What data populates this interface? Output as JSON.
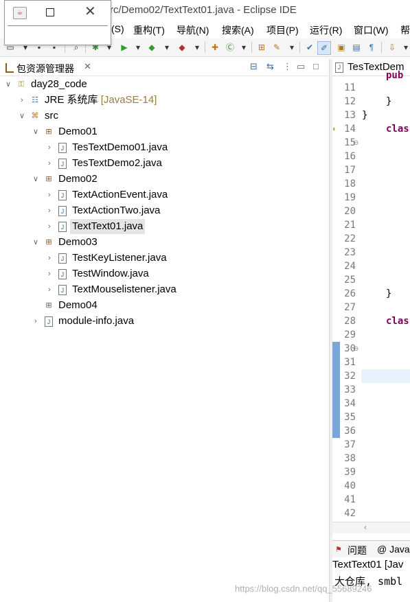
{
  "window": {
    "title": "rc/Demo02/TextText01.java - Eclipse IDE"
  },
  "menu": {
    "items": [
      {
        "label": "(S)"
      },
      {
        "label": "重构(T)"
      },
      {
        "label": "导航(N)"
      },
      {
        "label": "搜索(A)"
      },
      {
        "label": "项目(P)"
      },
      {
        "label": "运行(R)"
      },
      {
        "label": "窗口(W)"
      },
      {
        "label": "帮"
      }
    ]
  },
  "popup": {
    "app_icon": "java-app-icon"
  },
  "left_panel": {
    "title": "包资源管理器",
    "tree": [
      {
        "label": "day28_code",
        "icon": "project-icon"
      },
      {
        "label": "JRE 系统库",
        "suffix": "[JavaSE-14]",
        "icon": "library-icon"
      },
      {
        "label": "src",
        "icon": "source-folder-icon"
      },
      {
        "label": "Demo01",
        "icon": "package-icon"
      },
      {
        "label": "TesTextDemo01.java",
        "icon": "java-file-icon"
      },
      {
        "label": "TesTextDemo2.java",
        "icon": "java-file-icon"
      },
      {
        "label": "Demo02",
        "icon": "package-icon"
      },
      {
        "label": "TextActionEvent.java",
        "icon": "java-file-icon"
      },
      {
        "label": "TextActionTwo.java",
        "icon": "java-file-icon"
      },
      {
        "label": "TextText01.java",
        "icon": "java-file-icon",
        "selected": true
      },
      {
        "label": "Demo03",
        "icon": "package-icon"
      },
      {
        "label": "TestKeyListener.java",
        "icon": "java-file-icon"
      },
      {
        "label": "TestWindow.java",
        "icon": "java-file-icon"
      },
      {
        "label": "TextMouselistener.java",
        "icon": "java-file-icon"
      },
      {
        "label": "Demo04",
        "icon": "empty-package-icon"
      },
      {
        "label": "module-info.java",
        "icon": "java-file-icon"
      }
    ]
  },
  "editor": {
    "tab_label": "TesTextDem",
    "line_numbers": [
      "11",
      "12",
      "13",
      "14",
      "15",
      "16",
      "17",
      "18",
      "19",
      "20",
      "21",
      "22",
      "23",
      "24",
      "25",
      "26",
      "27",
      "28",
      "29",
      "30",
      "31",
      "32",
      "33",
      "34",
      "35",
      "36",
      "37",
      "38",
      "39",
      "40",
      "41",
      "42"
    ],
    "code": {
      "line10": "pub",
      "line12": "}",
      "line13": "}",
      "line14": "clas",
      "line26": "}",
      "line28": "clas"
    }
  },
  "console": {
    "tabs": [
      {
        "label": "问题"
      },
      {
        "label": "@ Java"
      }
    ],
    "title": "TextText01 [Jav",
    "output": "大仓库, smbl"
  },
  "watermark": "https://blog.csdn.net/qq_55689246",
  "colors": {
    "keyword": "#7f0055",
    "line_number": "#787878",
    "selection": "#e5e5e5",
    "change_marker": "#7aa6d8"
  }
}
